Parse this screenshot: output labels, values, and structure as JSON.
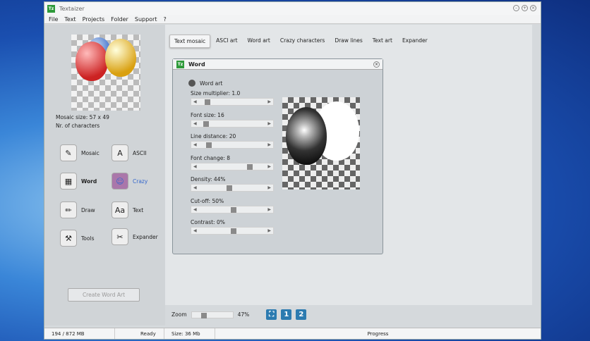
{
  "window": {
    "title": "Textaizer",
    "icon": "Tz"
  },
  "menu": [
    "File",
    "Text",
    "Projects",
    "Folder",
    "Support",
    "?"
  ],
  "left": {
    "mosaic_size": "Mosaic size: 57 x 49",
    "nr_chars": "Nr. of characters",
    "tools": [
      {
        "label": "Mosaic",
        "icon": "✎"
      },
      {
        "label": "ASCII",
        "icon": "A"
      },
      {
        "label": "Word",
        "icon": "▦"
      },
      {
        "label": "Crazy",
        "icon": "☺"
      },
      {
        "label": "Draw",
        "icon": "✏"
      },
      {
        "label": "Text",
        "icon": "Aa"
      },
      {
        "label": "Tools",
        "icon": "⚒"
      },
      {
        "label": "Expander",
        "icon": "✂"
      }
    ],
    "create_button": "Create Word Art"
  },
  "tabs": [
    "Text mosaic",
    "ASCI art",
    "Word art",
    "Crazy characters",
    "Draw lines",
    "Text art",
    "Expander"
  ],
  "dialog": {
    "title": "Word",
    "section": "Word art",
    "sliders": [
      {
        "label": "Size multiplier: 1.0",
        "value": 0.1
      },
      {
        "label": "Font size: 16",
        "value": 0.08
      },
      {
        "label": "Line distance: 20",
        "value": 0.12
      },
      {
        "label": "Font change: 8",
        "value": 0.75
      },
      {
        "label": "Density: 44%",
        "value": 0.44
      },
      {
        "label": "Cut-off: 50%",
        "value": 0.5
      },
      {
        "label": "Contrast: 0%",
        "value": 0.5
      }
    ]
  },
  "zoom": {
    "label": "Zoom",
    "value": "47%",
    "fraction": 0.2,
    "buttons": [
      "⛶",
      "1",
      "2"
    ]
  },
  "status": {
    "memory": "194 / 872 MB",
    "state": "Ready",
    "size": "Size: 36 Mb",
    "progress": "Progress"
  }
}
